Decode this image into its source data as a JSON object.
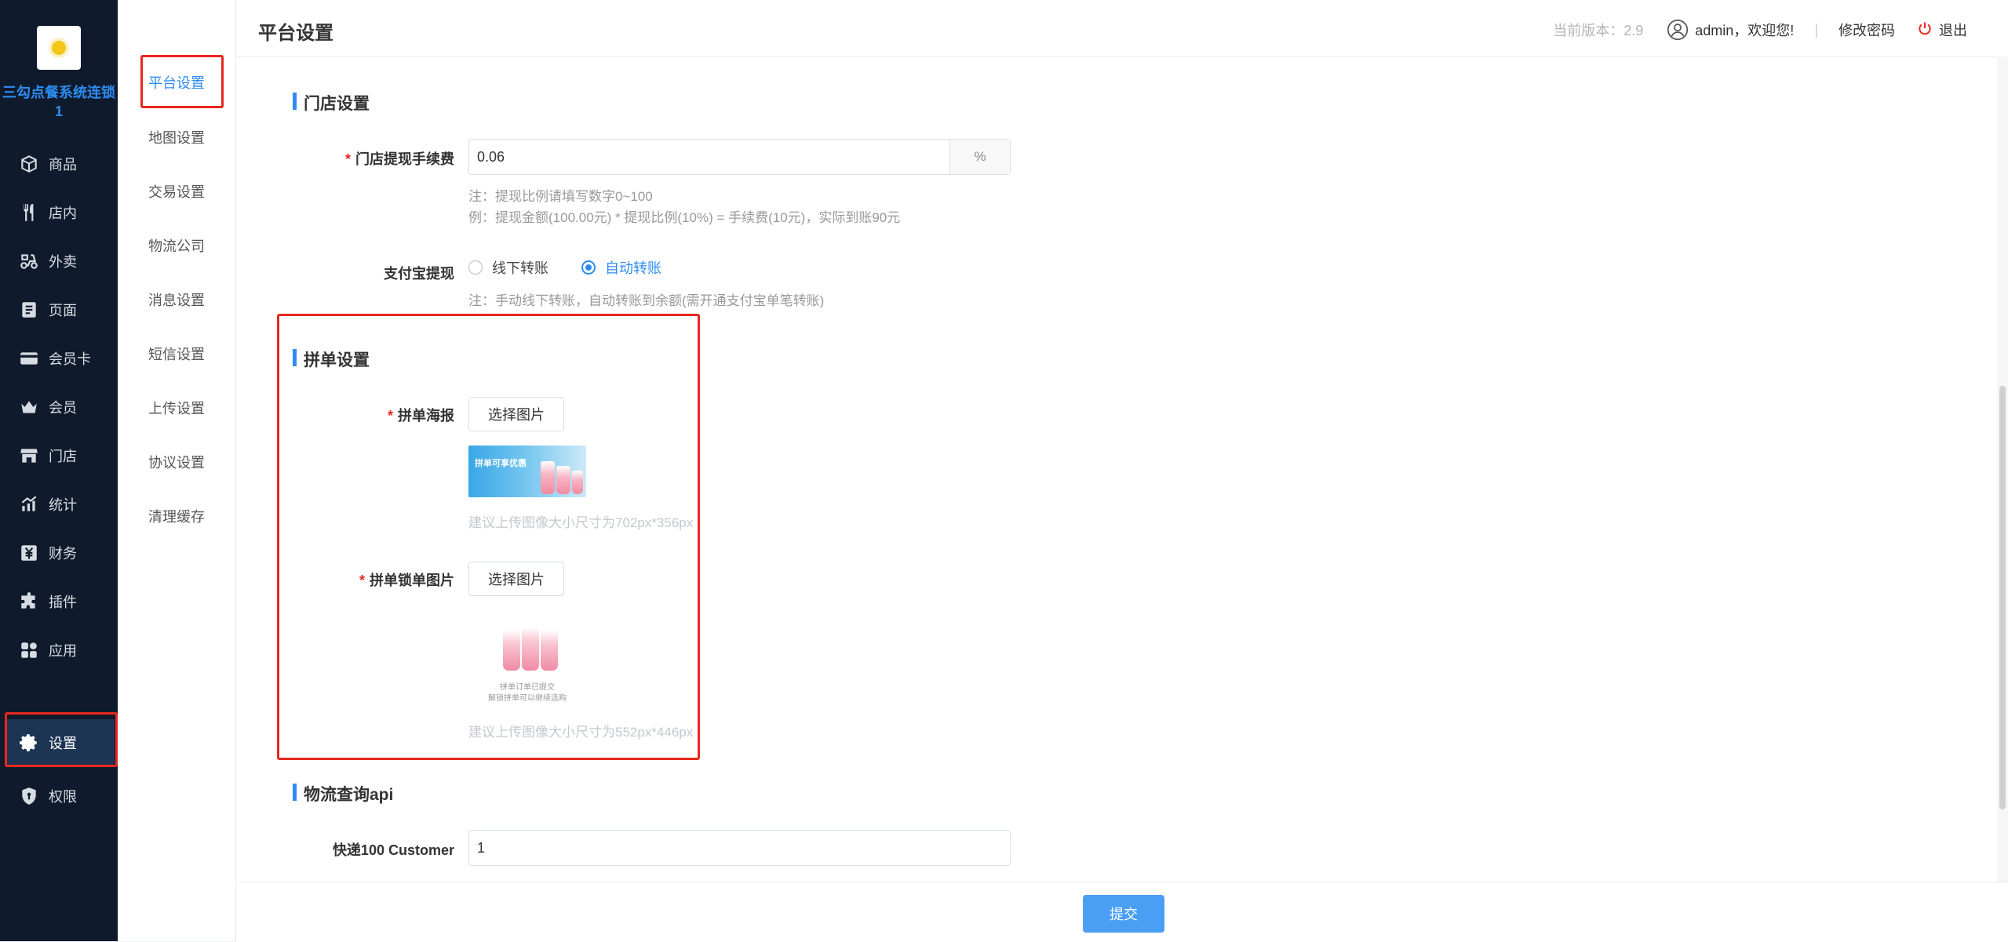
{
  "sidebar": {
    "brand": "三勾点餐系统连锁1",
    "items": [
      {
        "label": "商品",
        "icon": "box-icon"
      },
      {
        "label": "店内",
        "icon": "fork-knife-icon"
      },
      {
        "label": "外卖",
        "icon": "scooter-icon"
      },
      {
        "label": "页面",
        "icon": "page-icon"
      },
      {
        "label": "会员卡",
        "icon": "card-icon"
      },
      {
        "label": "会员",
        "icon": "crown-icon"
      },
      {
        "label": "门店",
        "icon": "store-icon"
      },
      {
        "label": "统计",
        "icon": "chart-icon"
      },
      {
        "label": "财务",
        "icon": "yuan-icon"
      },
      {
        "label": "插件",
        "icon": "puzzle-icon"
      },
      {
        "label": "应用",
        "icon": "apps-icon"
      },
      {
        "label": "设置",
        "icon": "gear-icon",
        "active": true
      },
      {
        "label": "权限",
        "icon": "shield-icon"
      }
    ]
  },
  "subnav": {
    "items": [
      "平台设置",
      "地图设置",
      "交易设置",
      "物流公司",
      "消息设置",
      "短信设置",
      "上传设置",
      "协议设置",
      "清理缓存"
    ],
    "active": "平台设置"
  },
  "header": {
    "title": "平台设置",
    "version": "当前版本：2.9",
    "user": "admin，欢迎您!",
    "separator": "|",
    "change_password": "修改密码",
    "logout": "退出"
  },
  "store_section": {
    "title": "门店设置",
    "fee_label": "门店提现手续费",
    "fee_value": "0.06",
    "fee_unit": "%",
    "note1": "注：提现比例请填写数字0~100",
    "note2": "例：提现金额(100.00元) * 提现比例(10%) = 手续费(10元)，实际到账90元",
    "alipay_label": "支付宝提现",
    "alipay_options": [
      "线下转账",
      "自动转账"
    ],
    "alipay_selected": "自动转账",
    "alipay_note": "注：手动线下转账，自动转账到余额(需开通支付宝单笔转账)"
  },
  "group_section": {
    "title": "拼单设置",
    "poster_label": "拼单海报",
    "poster_button": "选择图片",
    "poster_image_text": "拼单可享优惠",
    "poster_hint": "建议上传图像大小尺寸为702px*356px",
    "lock_label": "拼单锁单图片",
    "lock_button": "选择图片",
    "lock_caption1": "拼单订单已提交",
    "lock_caption2": "解锁拼单可以继续选购",
    "lock_hint": "建议上传图像大小尺寸为552px*446px"
  },
  "logistics_section": {
    "title": "物流查询api",
    "customer_label": "快递100 Customer",
    "customer_value": "1"
  },
  "footer": {
    "submit": "提交"
  },
  "colors": {
    "accent": "#2d8cf0",
    "sidebar_bg": "#0f1b2d",
    "highlight": "#e8271f",
    "submit": "#4a9ff5"
  }
}
